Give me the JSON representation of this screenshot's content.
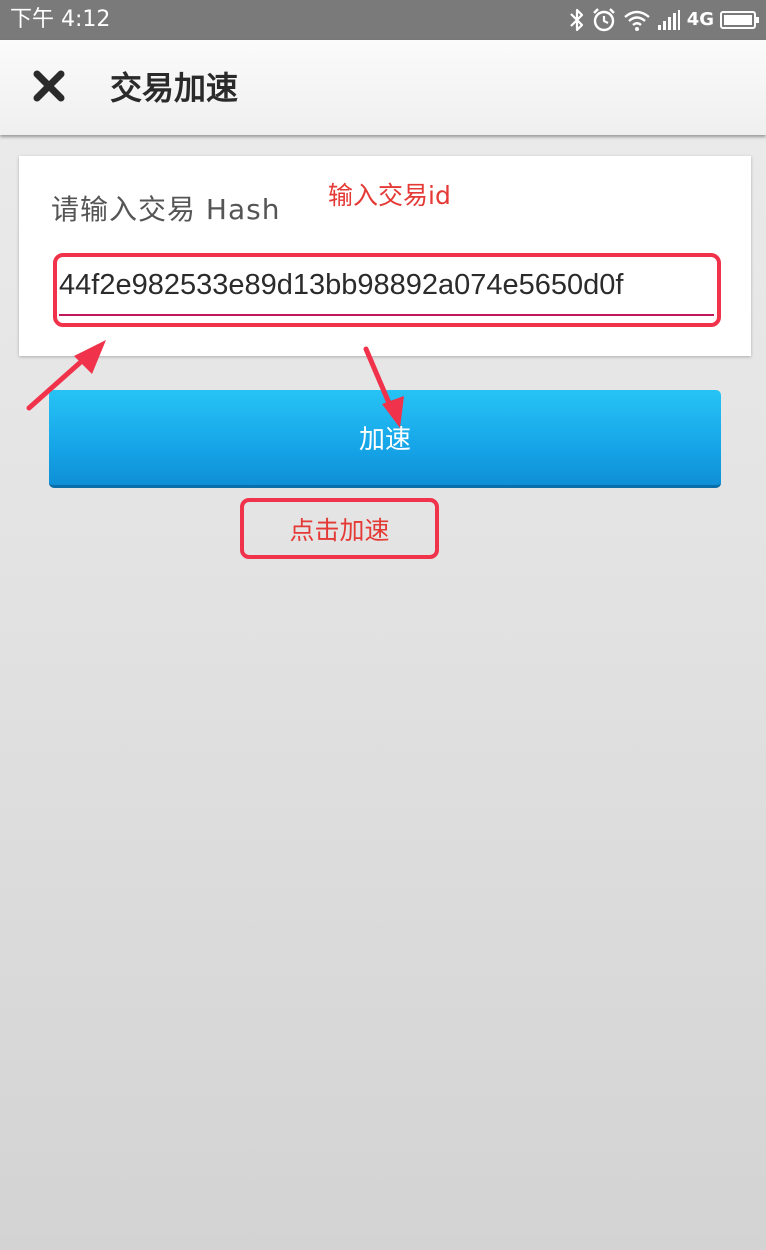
{
  "status_bar": {
    "time": "下午 4:12",
    "network": "4G",
    "icons": [
      "bluetooth-icon",
      "alarm-icon",
      "wifi-icon",
      "signal-icon",
      "battery-icon"
    ]
  },
  "app_bar": {
    "close_icon": "close-icon",
    "title": "交易加速"
  },
  "form": {
    "label": "请输入交易 Hash",
    "hash_value": "44f2e982533e89d13bb98892a074e5650d0f"
  },
  "button": {
    "label": "加速"
  },
  "annotations": {
    "input_hint": "输入交易id",
    "click_hint": "点击加速",
    "color": "#e53935"
  },
  "colors": {
    "button_blue": "#16a5e8",
    "input_underline": "#c2185b",
    "status_bar": "#7a7a7a"
  }
}
